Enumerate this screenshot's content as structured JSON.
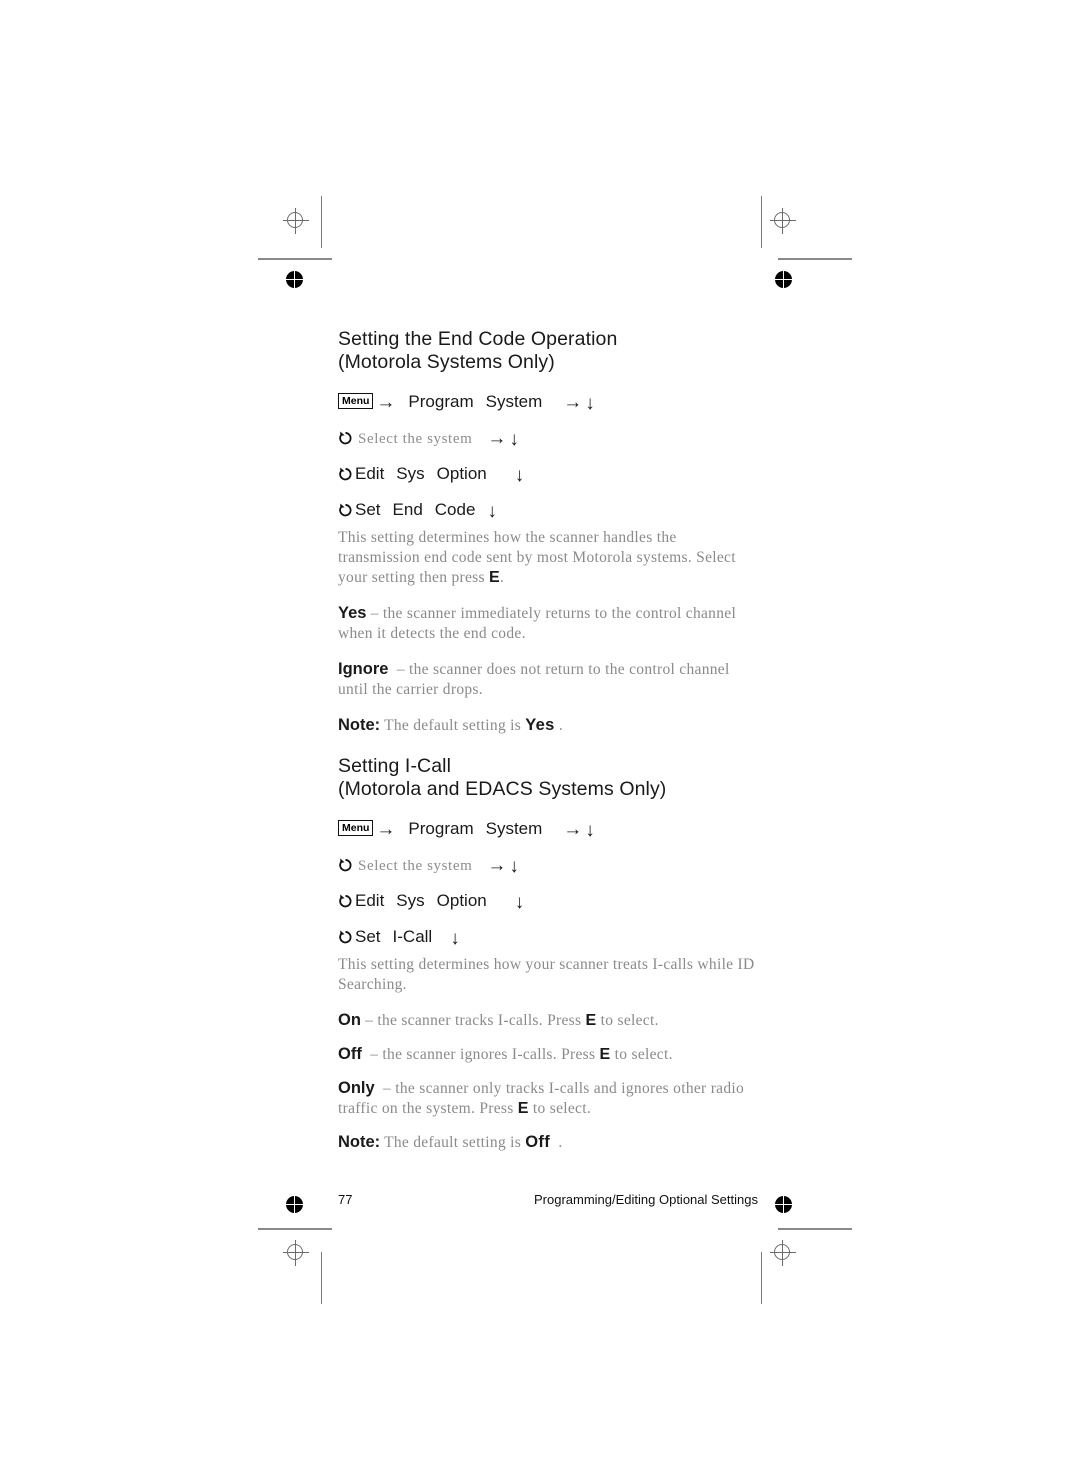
{
  "page": {
    "number": "77",
    "footer_chapter": "Programming/Editing Optional Settings"
  },
  "sections": [
    {
      "heading_line1": "Setting the End Code Operation",
      "heading_line2": "(Motorola Systems Only)",
      "nav": {
        "key_label": "Menu",
        "arrow_right": "→",
        "arrow_down": "↓",
        "rows": [
          {
            "label_a": "Program",
            "label_b": "System"
          },
          {
            "label_a": "Select the system"
          },
          {
            "label_a": "Edit",
            "label_b": "Sys",
            "label_c": "Option"
          },
          {
            "label_a": "Set",
            "label_b": "End",
            "label_c": "Code"
          }
        ]
      },
      "intro": {
        "text_a": "This setting determines how the scanner handles the transmission end code sent by most Motorola systems. Select your setting then press ",
        "keycap": "E",
        "text_b": "."
      },
      "options": [
        {
          "lead": "Yes",
          "text": "– the scanner immediately returns to the control channel when it detects the end code."
        },
        {
          "lead": "Ignore",
          "text": "– the scanner does not return to the control channel until the carrier drops."
        }
      ],
      "note": {
        "lead": "Note:",
        "text_a": "The default setting is ",
        "value": "Yes",
        "text_b": "."
      }
    },
    {
      "heading_line1": "Setting I-Call",
      "heading_line2": "(Motorola and EDACS Systems Only)",
      "nav": {
        "key_label": "Menu",
        "arrow_right": "→",
        "arrow_down": "↓",
        "rows": [
          {
            "label_a": "Program",
            "label_b": "System"
          },
          {
            "label_a": "Select the system"
          },
          {
            "label_a": "Edit",
            "label_b": "Sys",
            "label_c": "Option"
          },
          {
            "label_a": "Set",
            "label_b": "I-Call"
          }
        ]
      },
      "intro": {
        "text_a": "This setting determines how your scanner treats I-calls while ID Searching."
      },
      "options": [
        {
          "lead": "On",
          "text_a": "– the scanner tracks I-calls. Press ",
          "keycap": "E",
          "text_b": " to select."
        },
        {
          "lead": "Off",
          "text_a": "– the scanner ignores I-calls. Press ",
          "keycap": "E",
          "text_b": " to select."
        },
        {
          "lead": "Only",
          "text_a": "– the scanner only tracks I-calls and ignores other radio traffic on the system. Press ",
          "keycap": "E",
          "text_b": " to select."
        }
      ],
      "note": {
        "lead": "Note:",
        "text_a": "The default setting is ",
        "value": "Off",
        "text_b": "."
      }
    }
  ]
}
